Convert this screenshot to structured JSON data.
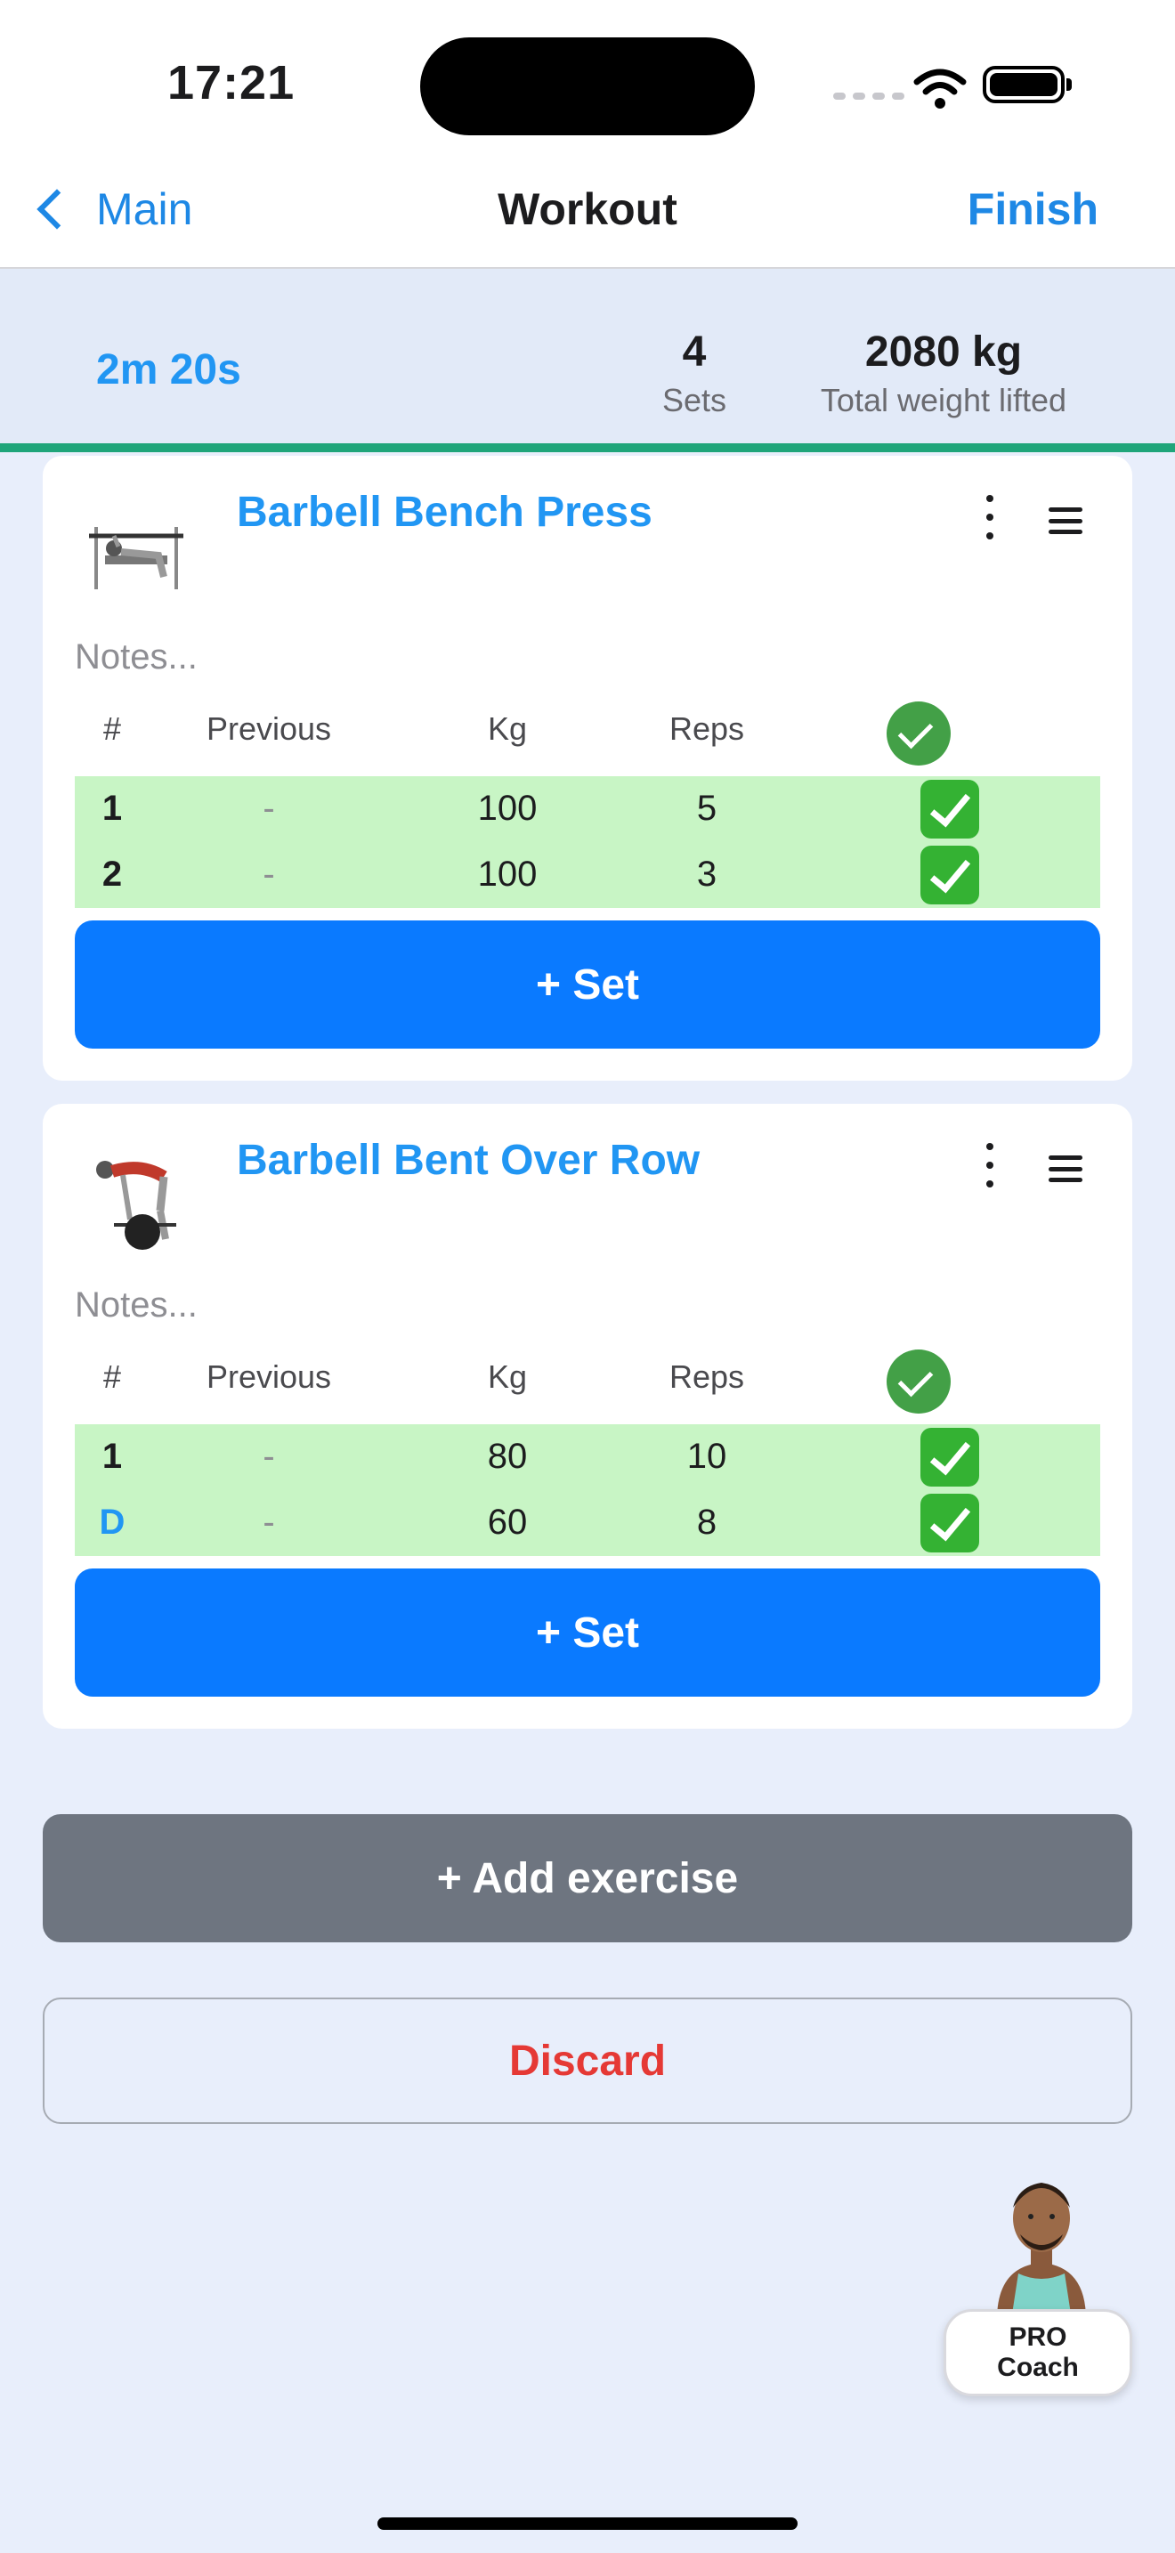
{
  "status_bar": {
    "time": "17:21"
  },
  "nav": {
    "back_label": "Main",
    "title": "Workout",
    "finish_label": "Finish"
  },
  "stats": {
    "timer": "2m 20s",
    "sets_value": "4",
    "sets_label": "Sets",
    "weight_value": "2080 kg",
    "weight_label": "Total weight lifted"
  },
  "table_headers": {
    "num": "#",
    "previous": "Previous",
    "kg": "Kg",
    "reps": "Reps"
  },
  "exercises": [
    {
      "name": "Barbell Bench Press",
      "notes_placeholder": "Notes...",
      "sets": [
        {
          "label": "1",
          "previous": "-",
          "kg": "100",
          "reps": "5",
          "done": true
        },
        {
          "label": "2",
          "previous": "-",
          "kg": "100",
          "reps": "3",
          "done": true
        }
      ],
      "add_set_label": "+ Set"
    },
    {
      "name": "Barbell Bent Over Row",
      "notes_placeholder": "Notes...",
      "sets": [
        {
          "label": "1",
          "previous": "-",
          "kg": "80",
          "reps": "10",
          "done": true
        },
        {
          "label": "D",
          "previous": "-",
          "kg": "60",
          "reps": "8",
          "done": true
        }
      ],
      "add_set_label": "+ Set"
    }
  ],
  "add_exercise_label": "+ Add exercise",
  "discard_label": "Discard",
  "coach": {
    "line1": "PRO",
    "line2": "Coach"
  },
  "colors": {
    "accent": "#2196f3",
    "primary_button": "#0a7aff",
    "done_row": "#c8f5c5",
    "progress": "#1fa57a",
    "danger": "#e53935"
  }
}
